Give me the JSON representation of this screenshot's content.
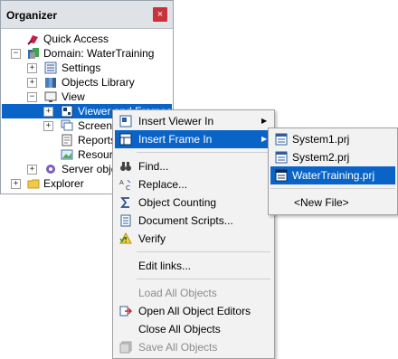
{
  "organizer": {
    "title": "Organizer",
    "close_glyph": "×",
    "tree": [
      {
        "label": "Quick Access",
        "icon": "quick-access-icon"
      },
      {
        "label": "Domain: WaterTraining",
        "icon": "domain-icon",
        "expander": "−"
      },
      {
        "label": "Settings",
        "icon": "settings-icon",
        "expander": "+"
      },
      {
        "label": "Objects Library",
        "icon": "objects-library-icon",
        "expander": "+"
      },
      {
        "label": "View",
        "icon": "view-icon",
        "expander": "−"
      },
      {
        "label": "Viewer and Frames",
        "icon": "viewer-frames-icon",
        "expander": "+",
        "selected": true
      },
      {
        "label": "Screens",
        "icon": "screens-icon",
        "expander": "+"
      },
      {
        "label": "Reports",
        "icon": "reports-icon"
      },
      {
        "label": "Resources",
        "icon": "resources-icon"
      },
      {
        "label": "Server objects",
        "icon": "server-objects-icon",
        "expander": "+"
      },
      {
        "label": "Explorer",
        "icon": "explorer-folder-icon",
        "expander": "+"
      }
    ]
  },
  "context_menu": {
    "items": [
      {
        "label": "Insert Viewer In",
        "icon": "insert-viewer-icon",
        "submenu": true
      },
      {
        "label": "Insert Frame In",
        "icon": "insert-frame-icon",
        "submenu": true,
        "highlighted": true
      },
      {
        "label": "Find...",
        "icon": "binoculars-icon"
      },
      {
        "label": "Replace...",
        "icon": "replace-icon"
      },
      {
        "label": "Object Counting",
        "icon": "sigma-icon"
      },
      {
        "label": "Document Scripts...",
        "icon": "document-scripts-icon"
      },
      {
        "label": "Verify",
        "icon": "verify-warning-icon"
      },
      {
        "label": "Edit links..."
      },
      {
        "label": "Load All Objects",
        "disabled": true
      },
      {
        "label": "Open All Object Editors",
        "icon": "open-editors-icon"
      },
      {
        "label": "Close All Objects"
      },
      {
        "label": "Save All Objects",
        "icon": "save-all-icon",
        "disabled": true
      }
    ]
  },
  "submenu": {
    "items": [
      {
        "label": "System1.prj",
        "icon": "project-file-icon"
      },
      {
        "label": "System2.prj",
        "icon": "project-file-icon"
      },
      {
        "label": "WaterTraining.prj",
        "icon": "project-file-icon",
        "highlighted": true
      },
      {
        "label": "<New File>"
      }
    ]
  },
  "colors": {
    "selection": "#0a64c8",
    "close_button": "#c8333b",
    "menu_bg": "#f2f2f2"
  }
}
